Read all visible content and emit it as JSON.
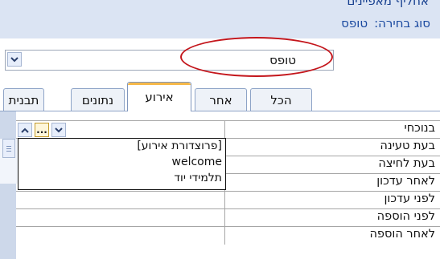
{
  "header": {
    "title": "אחליף מאפיינים",
    "selection_label": "סוג בחירה:",
    "selection_value": "טופס"
  },
  "selector": {
    "value": "טופס",
    "dropdown_icon": "chevron-down-icon"
  },
  "tabs": [
    {
      "label": "תבנית",
      "active": false
    },
    {
      "label": "נתונים",
      "active": false
    },
    {
      "label": "אירוע",
      "active": true
    },
    {
      "label": "אחר",
      "active": false
    },
    {
      "label": "הכל",
      "active": false
    }
  ],
  "properties": [
    {
      "name": "בנוכחי",
      "value": ""
    },
    {
      "name": "בעת טעינה",
      "value": ""
    },
    {
      "name": "בעת לחיצה",
      "value": ""
    },
    {
      "name": "לאחר עדכון",
      "value": ""
    },
    {
      "name": "לפני עדכון",
      "value": ""
    },
    {
      "name": "לפני הוספה",
      "value": ""
    },
    {
      "name": "לאחר הוספה",
      "value": ""
    }
  ],
  "value_controls": {
    "builder_label": "...",
    "up_icon": "chevron-up-icon",
    "down_icon": "chevron-down-icon"
  },
  "dropdown_list": {
    "items": [
      "[פרוצדורת אירוע]",
      "welcome",
      "תלמידי יוד"
    ]
  },
  "colors": {
    "header_background": "#dbe4f3",
    "label_text": "#1b4aa0",
    "highlight_ellipse": "#c4161c",
    "active_tab_accent": "#f6b94a"
  }
}
